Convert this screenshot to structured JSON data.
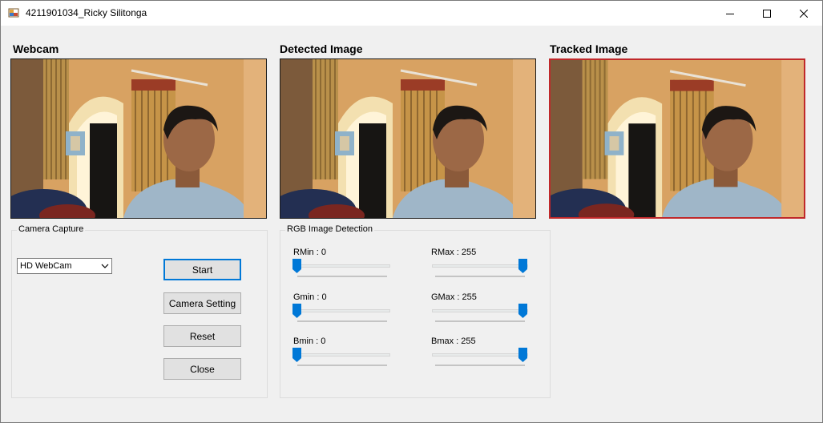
{
  "window": {
    "title": "4211901034_Ricky Silitonga",
    "icon": "app-icon",
    "controls": [
      "minimize-icon",
      "maximize-icon",
      "close-icon"
    ]
  },
  "panels": {
    "webcam": "Webcam",
    "detected": "Detected Image",
    "tracked": "Tracked Image"
  },
  "camera_capture": {
    "group_label": "Camera Capture",
    "device": "HD WebCam",
    "buttons": {
      "start": "Start",
      "camera_setting": "Camera Setting",
      "reset": "Reset",
      "close": "Close"
    }
  },
  "rgb_detection": {
    "group_label": "RGB Image Detection",
    "sliders": {
      "rmin": {
        "label": "RMin : 0",
        "value": 0
      },
      "rmax": {
        "label": "RMax : 255",
        "value": 255
      },
      "gmin": {
        "label": "Gmin : 0",
        "value": 0
      },
      "gmax": {
        "label": "GMax : 255",
        "value": 255
      },
      "bmin": {
        "label": "Bmin : 0",
        "value": 0
      },
      "bmax": {
        "label": "Bmax : 255",
        "value": 255
      }
    },
    "range_max": 255
  },
  "colors": {
    "accent": "#0078d7",
    "tracked_border": "#c0282a"
  }
}
